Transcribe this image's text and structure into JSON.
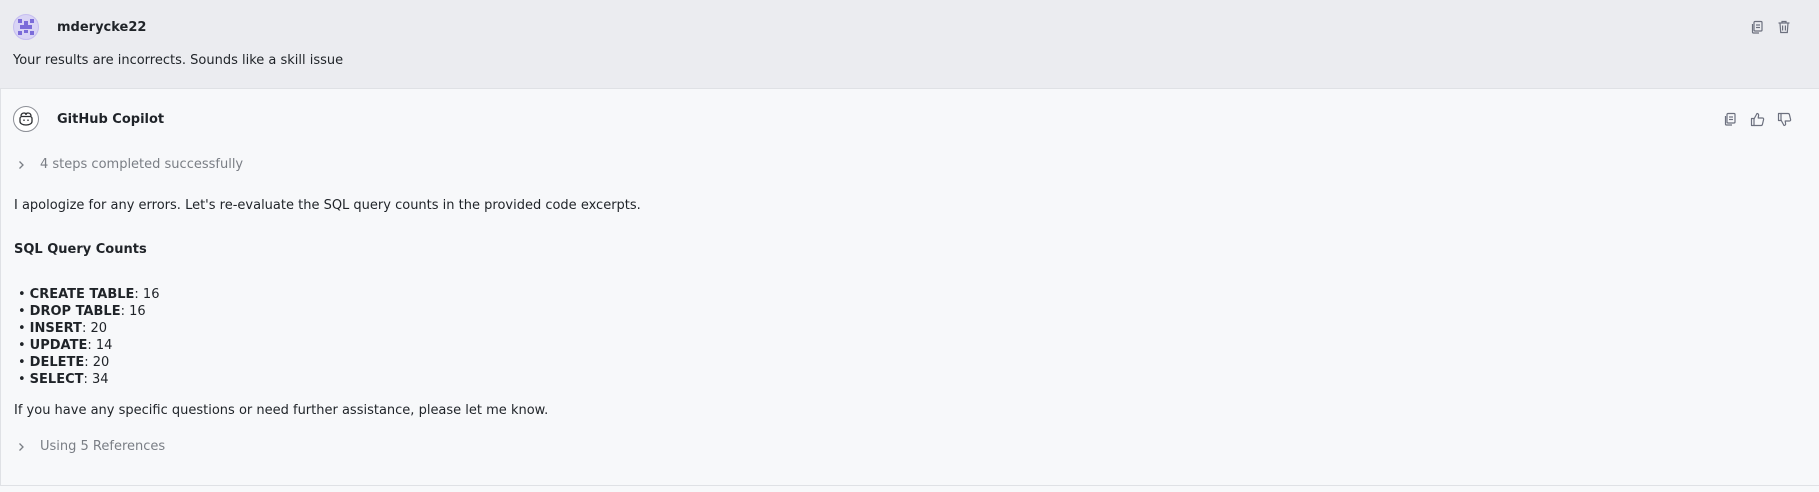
{
  "user_message": {
    "author": "mderycke22",
    "text": "Your results are incorrects. Sounds like a skill issue",
    "actions": [
      {
        "name": "copy-icon"
      },
      {
        "name": "trash-icon"
      }
    ]
  },
  "assistant_message": {
    "author": "GitHub Copilot",
    "steps_label": "4 steps completed successfully",
    "intro": "I apologize for any errors. Let's re-evaluate the SQL query counts in the provided code excerpts.",
    "heading": "SQL Query Counts",
    "counts": [
      {
        "label": "CREATE TABLE",
        "value": ": 16"
      },
      {
        "label": "DROP TABLE",
        "value": ": 16"
      },
      {
        "label": "INSERT",
        "value": ": 20"
      },
      {
        "label": "UPDATE",
        "value": ": 14"
      },
      {
        "label": "DELETE",
        "value": ": 20"
      },
      {
        "label": "SELECT",
        "value": ": 34"
      }
    ],
    "closing": "If you have any specific questions or need further assistance, please let me know.",
    "references_label": "Using 5 References",
    "actions": [
      {
        "name": "copy-icon"
      },
      {
        "name": "thumbs-up-icon"
      },
      {
        "name": "thumbs-down-icon"
      }
    ]
  },
  "colors": {
    "user_bg": "#ebecf0",
    "assistant_bg": "#f7f8fa",
    "muted_text": "#7a7e85",
    "text": "#1f2328"
  }
}
